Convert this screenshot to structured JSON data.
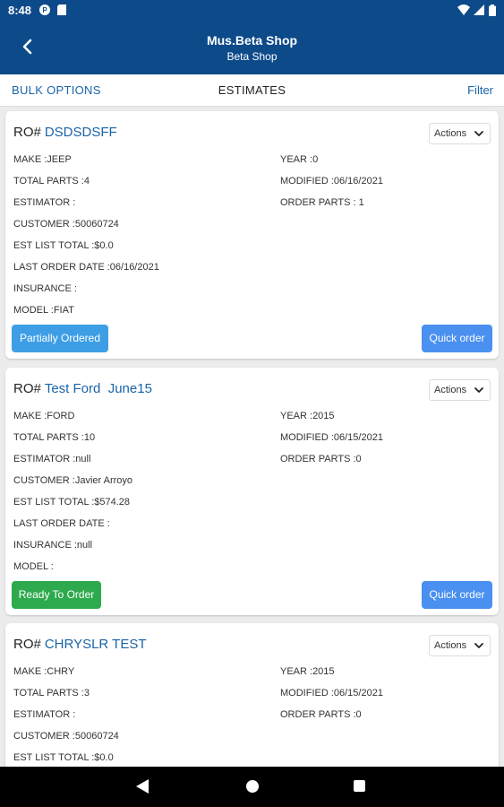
{
  "status_bar": {
    "time": "8:48"
  },
  "app_bar": {
    "title": "Mus.Beta Shop",
    "subtitle": "Beta Shop"
  },
  "tabs": {
    "bulk": "BULK OPTIONS",
    "estimates": "ESTIMATES",
    "filter": "Filter"
  },
  "cards": [
    {
      "ro_label": "RO#",
      "ro_number": "DSDSDSFF",
      "actions": "Actions",
      "make": "MAKE :JEEP",
      "year": "YEAR :0",
      "total_parts": "TOTAL PARTS :4",
      "modified": "MODIFIED :06/16/2021",
      "estimator": "ESTIMATOR :",
      "order_parts": "ORDER PARTS : 1",
      "customer": "CUSTOMER :50060724",
      "est_list_total": "EST LIST TOTAL :$0.0",
      "last_order_date": "LAST ORDER DATE :06/16/2021",
      "insurance": "INSURANCE :",
      "model": "MODEL :FIAT",
      "status": "Partially Ordered",
      "status_color": "#3d9ee6",
      "quick_order": "Quick order"
    },
    {
      "ro_label": "RO#",
      "ro_number": "Test Ford  June15",
      "actions": "Actions",
      "make": "MAKE :FORD",
      "year": "YEAR :2015",
      "total_parts": "TOTAL PARTS :10",
      "modified": "MODIFIED :06/15/2021",
      "estimator": "ESTIMATOR :null",
      "order_parts": "ORDER PARTS :0",
      "customer": "CUSTOMER :Javier Arroyo",
      "est_list_total": "EST LIST TOTAL :$574.28",
      "last_order_date": "LAST ORDER DATE :",
      "insurance": "INSURANCE :null",
      "model": "MODEL :",
      "status": "Ready To Order",
      "status_color": "#2eaa4e",
      "quick_order": "Quick order"
    },
    {
      "ro_label": "RO#",
      "ro_number": "CHRYSLR TEST",
      "actions": "Actions",
      "make": "MAKE :CHRY",
      "year": "YEAR :2015",
      "total_parts": "TOTAL PARTS :3",
      "modified": "MODIFIED :06/15/2021",
      "estimator": "ESTIMATOR :",
      "order_parts": "ORDER PARTS :0",
      "customer": "CUSTOMER :50060724",
      "est_list_total": "EST LIST TOTAL :$0.0"
    }
  ],
  "colors": {
    "primary": "#0d4a8a",
    "link": "#1a64a8",
    "quick_order": "#4a90f0"
  },
  "icons": {
    "back": "arrow-back-icon",
    "actions": "chevron-down-icon"
  }
}
